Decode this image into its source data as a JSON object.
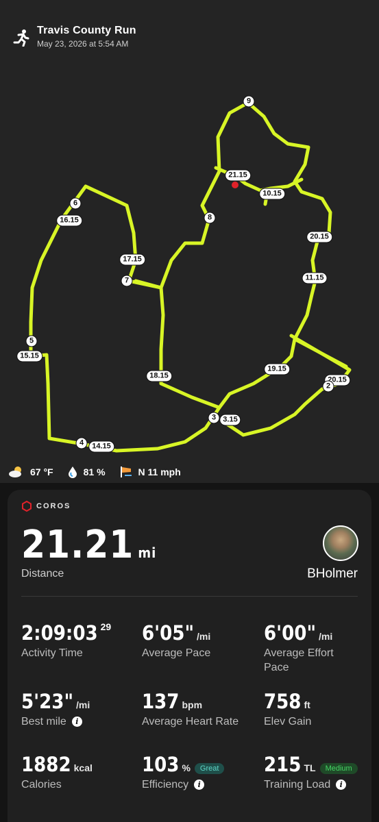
{
  "header": {
    "title": "Travis County Run",
    "date": "May 23, 2026 at 5:54 AM",
    "icon": "runner-icon"
  },
  "map": {
    "route_color": "#D8F526",
    "start_color": "#22C24A",
    "end_color": "#E0222A",
    "markers": [
      "9",
      "21.15",
      "10.15",
      "8",
      "6",
      "16.15",
      "20.15",
      "17.15",
      "7",
      "11.15",
      "5",
      "15.15",
      "19.15",
      "18.15",
      "20.15",
      "2",
      "3",
      "3.15",
      "4",
      "14.15"
    ]
  },
  "weather": {
    "temp": "67 °F",
    "humidity": "81 %",
    "wind": "N 11 mph"
  },
  "card": {
    "brand": "COROS",
    "distance": {
      "value": "21.21",
      "unit": "mi",
      "label": "Distance"
    },
    "user": {
      "name": "BHolmer"
    },
    "stats": {
      "activity_time": {
        "value": "2:09:03",
        "sup": "29",
        "label": "Activity Time"
      },
      "avg_pace": {
        "value": "6'05\"",
        "unit": "/mi",
        "label": "Average Pace"
      },
      "effort_pace": {
        "value": "6'00\"",
        "unit": "/mi",
        "label": "Average Effort Pace"
      },
      "best_mile": {
        "value": "5'23\"",
        "unit": "/mi",
        "label": "Best mile"
      },
      "heart_rate": {
        "value": "137",
        "unit": "bpm",
        "label": "Average Heart Rate"
      },
      "elev_gain": {
        "value": "758",
        "unit": "ft",
        "label": "Elev Gain"
      },
      "calories": {
        "value": "1882",
        "unit": "kcal",
        "label": "Calories"
      },
      "efficiency": {
        "value": "103",
        "unit": "%",
        "badge": "Great",
        "label": "Efficiency"
      },
      "training_load": {
        "value": "215",
        "unit": "TL",
        "badge": "Medium",
        "label": "Training Load"
      }
    }
  }
}
